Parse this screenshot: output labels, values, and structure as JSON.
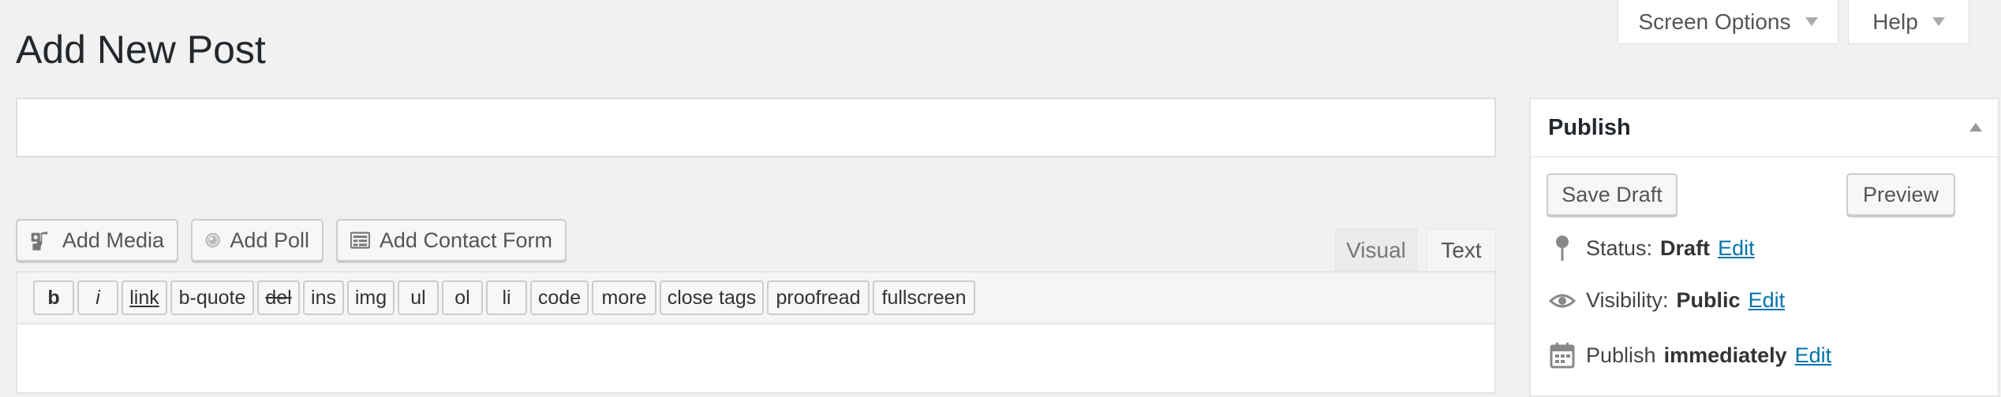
{
  "header": {
    "screen_options_label": "Screen Options",
    "help_label": "Help",
    "page_title": "Add New Post"
  },
  "title_input": {
    "value": "",
    "placeholder": ""
  },
  "media_buttons": [
    {
      "label": "Add Media",
      "icon": "add-media-icon"
    },
    {
      "label": "Add Poll",
      "icon": "poll-icon"
    },
    {
      "label": "Add Contact Form",
      "icon": "contact-form-icon"
    }
  ],
  "editor_tabs": {
    "visual": "Visual",
    "text": "Text",
    "active": "Text"
  },
  "quicktags": [
    "b",
    "i",
    "link",
    "b-quote",
    "del",
    "ins",
    "img",
    "ul",
    "ol",
    "li",
    "code",
    "more",
    "close tags",
    "proofread",
    "fullscreen"
  ],
  "publish": {
    "title": "Publish",
    "save_draft": "Save Draft",
    "preview": "Preview",
    "status_label": "Status:",
    "status_value": "Draft",
    "visibility_label": "Visibility:",
    "visibility_value": "Public",
    "publish_label": "Publish",
    "publish_value": "immediately",
    "edit_label": "Edit"
  },
  "colors": {
    "background": "#f1f1f1",
    "link": "#0073aa",
    "panel": "#ffffff"
  }
}
